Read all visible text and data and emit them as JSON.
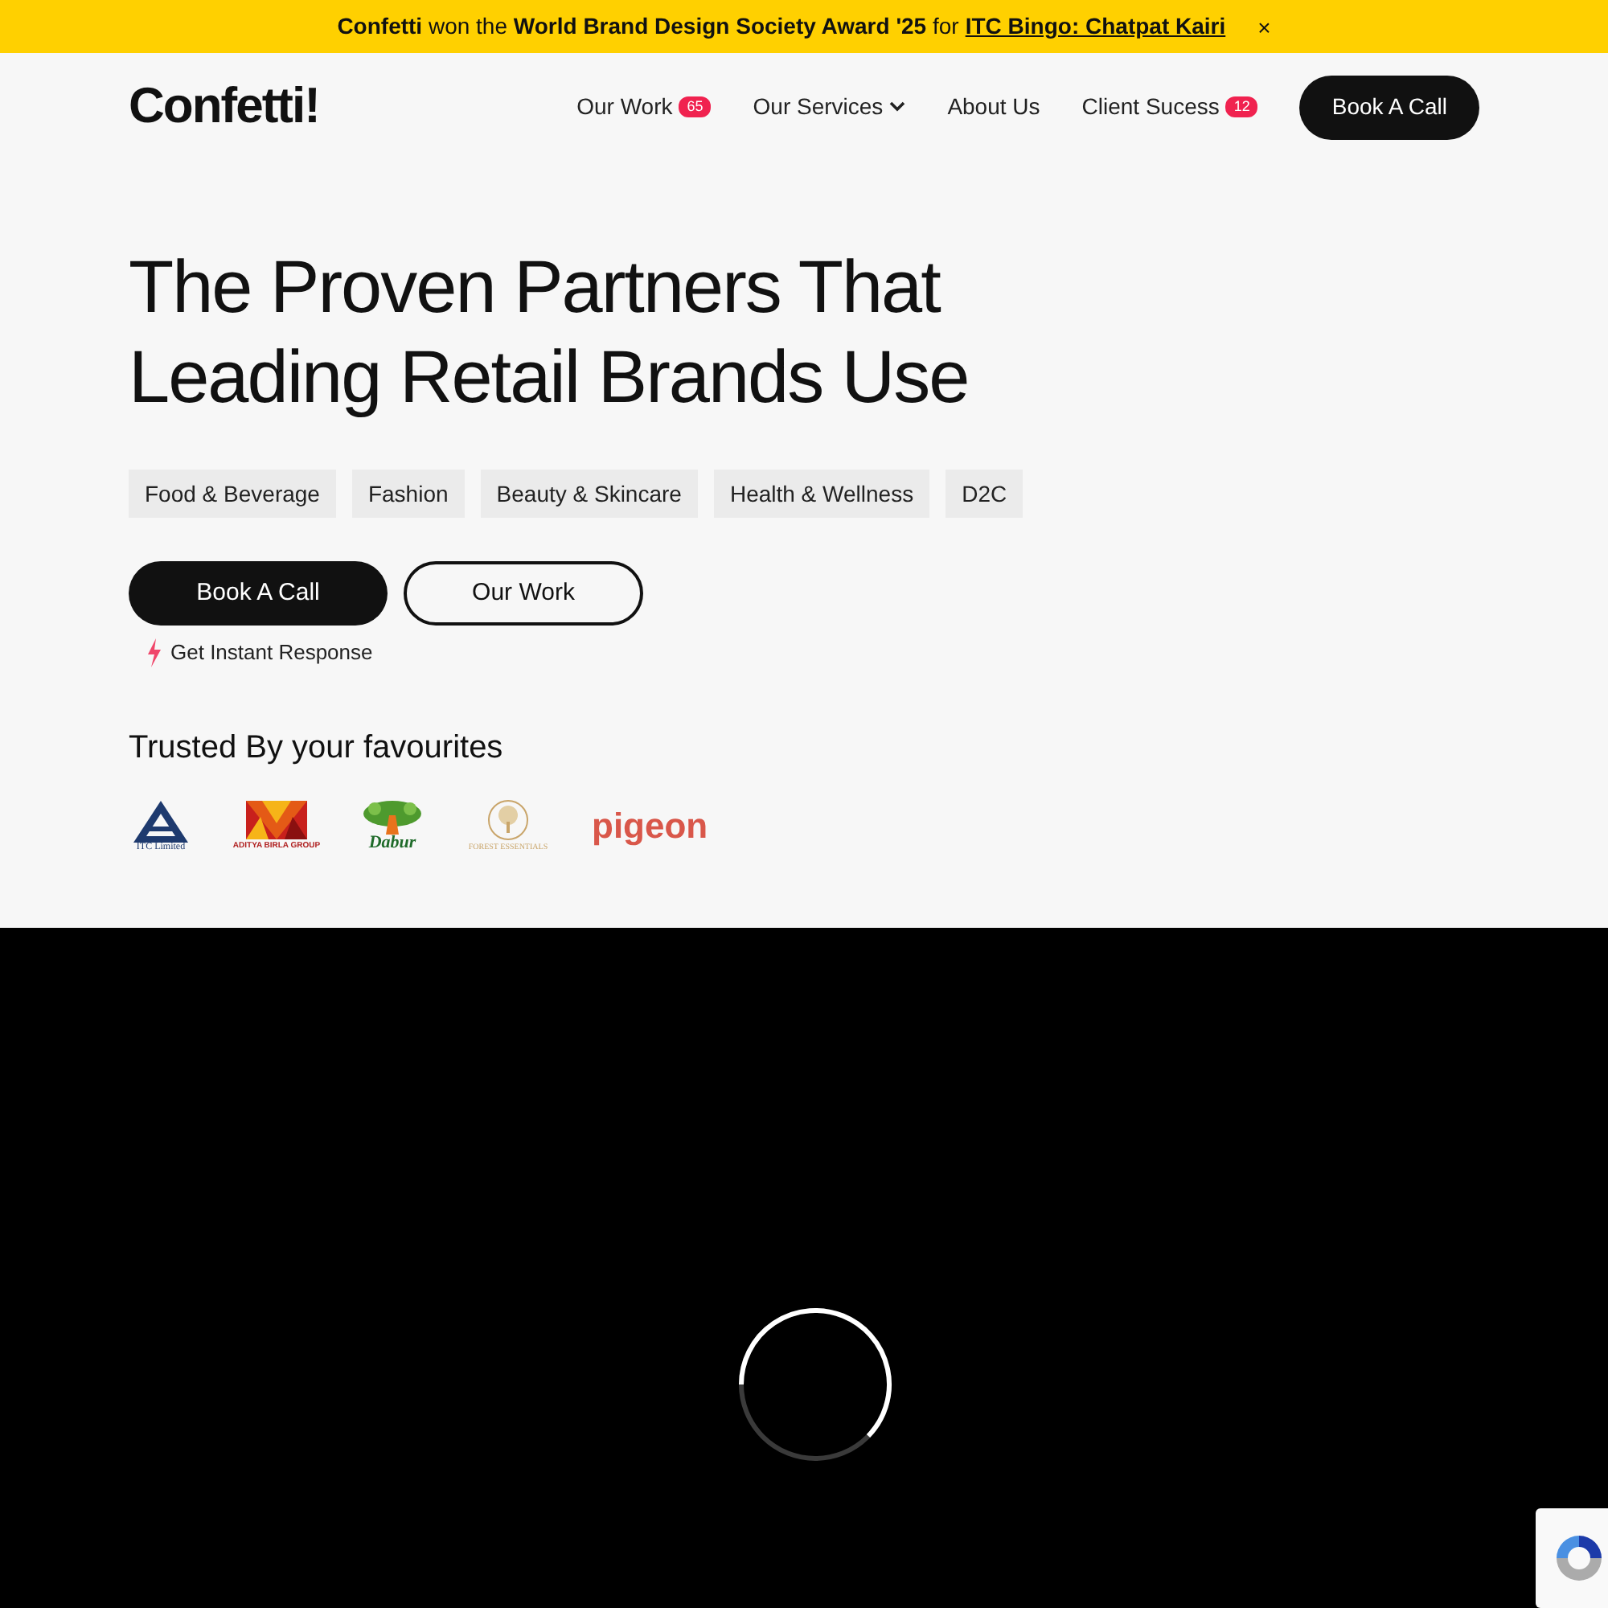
{
  "announcement": {
    "text": "**Confetti** won the **World Brand Design Society Award '25** for",
    "link": "ITC Bingo: Chatpat Kairi",
    "close": "×"
  },
  "nav": {
    "logo": "Confetti!",
    "items": [
      {
        "label": "Our Work",
        "badge": "65",
        "dropdown": false
      },
      {
        "label": "Our Services",
        "dropdown": true
      },
      {
        "label": "About Us",
        "dropdown": false
      },
      {
        "label": "Client Sucess",
        "badge": "12",
        "dropdown": false
      }
    ],
    "cta": "Book A Call"
  },
  "hero": {
    "title_lines": [
      "The Proven Partners That",
      "Leading Retail Brands Use"
    ],
    "tags": [
      "Food & Beverage",
      "Fashion",
      "Beauty & Skincare",
      "Health & Wellness",
      "D2C"
    ],
    "primary_button": "Book A Call",
    "secondary_button": "Our Work",
    "note": "Get Instant Response"
  },
  "trusted": {
    "heading": "Trusted By your favourites",
    "logos": [
      {
        "kind": "itc",
        "caption": "ITC Limited"
      },
      {
        "kind": "birla",
        "caption": "ADITYA BIRLA GROUP"
      },
      {
        "kind": "dabur",
        "caption": "Dabur"
      },
      {
        "kind": "forest",
        "caption": "FOREST ESSENTIALS"
      },
      {
        "kind": "pigeon",
        "caption": "pigeon"
      }
    ]
  }
}
